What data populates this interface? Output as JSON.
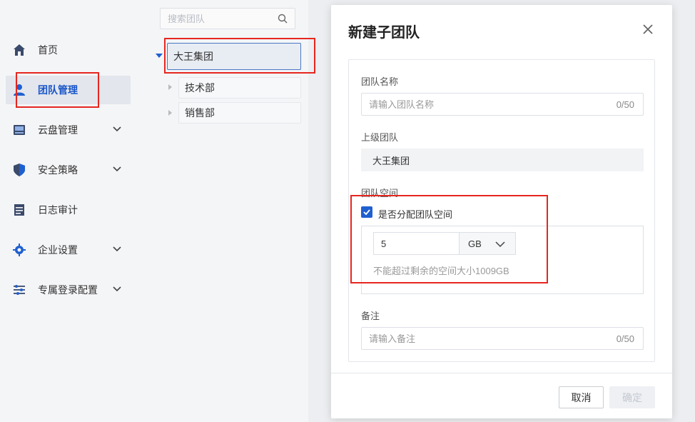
{
  "sidebar": {
    "items": [
      {
        "label": "首页",
        "icon": "home-icon",
        "expandable": false,
        "active": false
      },
      {
        "label": "团队管理",
        "icon": "user-icon",
        "expandable": false,
        "active": true
      },
      {
        "label": "云盘管理",
        "icon": "disk-icon",
        "expandable": true,
        "active": false
      },
      {
        "label": "安全策略",
        "icon": "shield-icon",
        "expandable": true,
        "active": false
      },
      {
        "label": "日志审计",
        "icon": "log-icon",
        "expandable": false,
        "active": false
      },
      {
        "label": "企业设置",
        "icon": "gear-icon",
        "expandable": true,
        "active": false
      },
      {
        "label": "专属登录配置",
        "icon": "sliders-icon",
        "expandable": true,
        "active": false
      }
    ]
  },
  "tree": {
    "search_placeholder": "搜索团队",
    "root": "大王集团",
    "children": [
      "技术部",
      "销售部"
    ]
  },
  "modal": {
    "title": "新建子团队",
    "team_name_label": "团队名称",
    "team_name_placeholder": "请输入团队名称",
    "team_name_counter": "0/50",
    "parent_label": "上级团队",
    "parent_value": "大王集团",
    "space_label": "团队空间",
    "allocate_label": "是否分配团队空间",
    "allocate_checked": true,
    "space_value": "5",
    "space_unit": "GB",
    "space_hint": "不能超过剩余的空间大小1009GB",
    "remark_label": "备注",
    "remark_placeholder": "请输入备注",
    "remark_counter": "0/50",
    "cancel_label": "取消",
    "ok_label": "确定"
  },
  "colors": {
    "accent": "#1f60d0",
    "highlight": "#e6261f"
  }
}
